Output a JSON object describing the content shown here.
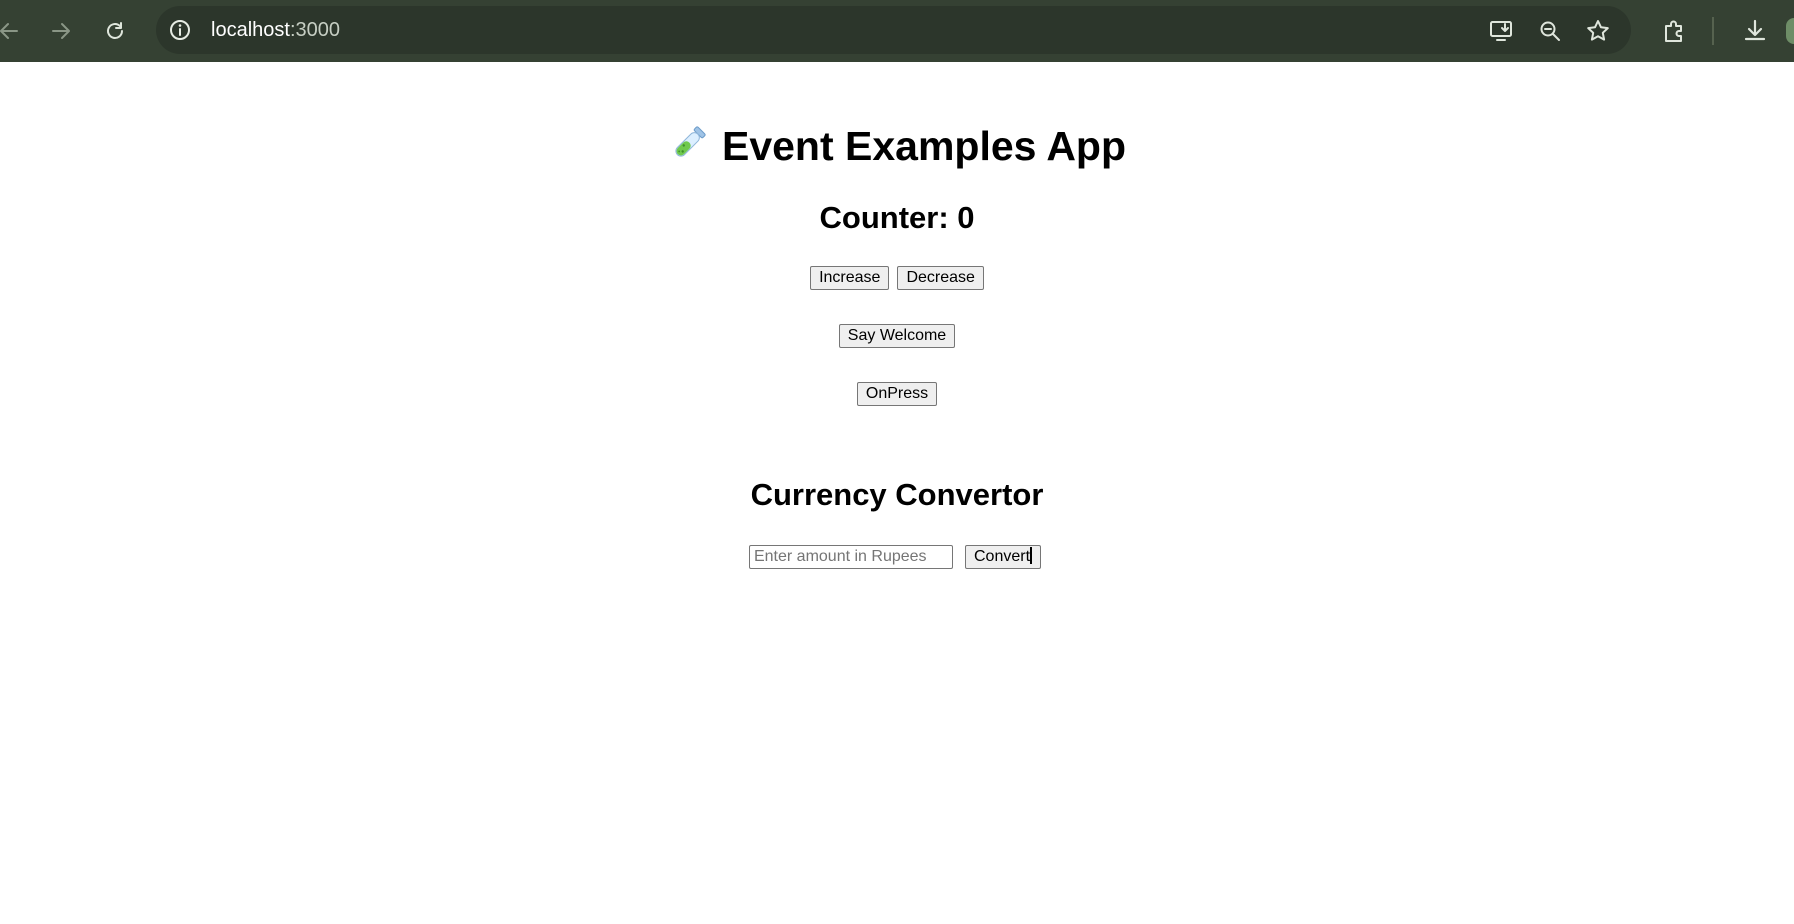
{
  "browser": {
    "url_host": "localhost",
    "url_port": ":3000",
    "icons": [
      "back-arrow-icon",
      "forward-arrow-icon",
      "reload-icon",
      "info-icon",
      "install-app-icon",
      "zoom-icon",
      "bookmark-star-icon",
      "extensions-icon",
      "download-icon"
    ],
    "toolbar_color": "#354133"
  },
  "app": {
    "title": "Event Examples App",
    "title_icon": "test-tube-icon",
    "counter_label": "Counter: 0",
    "increase_label": "Increase",
    "decrease_label": "Decrease",
    "welcome_label": "Say Welcome",
    "onpress_label": "OnPress"
  },
  "currency": {
    "heading": "Currency Convertor",
    "input_placeholder": "Enter amount in Rupees",
    "input_value": "",
    "convert_label": "Convert"
  }
}
